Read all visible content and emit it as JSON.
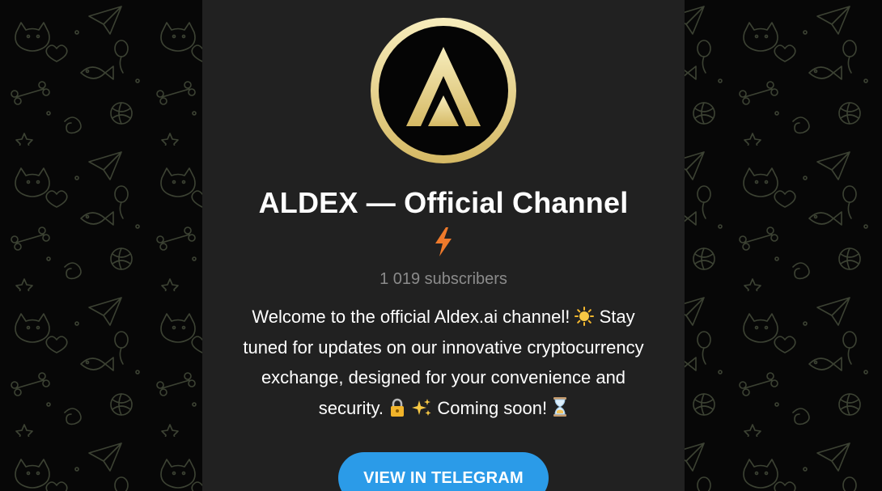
{
  "channel": {
    "title": "ALDEX — Official Channel",
    "subscribers": "1 019 subscribers",
    "description": {
      "line1_text": "Welcome to the official Aldex.ai channel! ",
      "line1_tail": " Stay",
      "line2": "tuned for updates on our innovative cryptocurrency",
      "line3": "exchange, designed for your convenience and",
      "line4_start": "security. ",
      "line4_mid": " Coming soon! "
    }
  },
  "actions": {
    "view_label": "VIEW IN TELEGRAM"
  },
  "icons": {
    "title_badge": "lightning-bolt-icon",
    "emoji_1": "sun-icon",
    "emoji_2": "locked-with-key-icon",
    "emoji_3": "sparkles-icon",
    "emoji_4": "hourglass-icon"
  },
  "colors": {
    "accent": "#2b9be8",
    "card_bg": "#212121",
    "background": "#070707",
    "logo_gold": "#e8d58c",
    "bolt": "#ef7a2b"
  }
}
